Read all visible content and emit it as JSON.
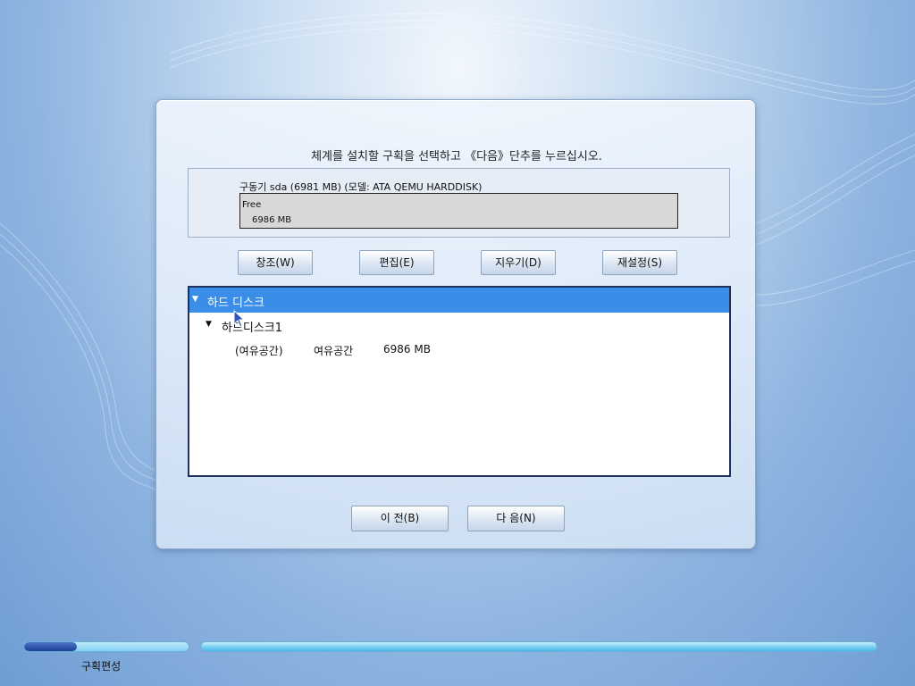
{
  "dialog": {
    "instruction": "체계를 설치할 구획을 선택하고 《다음》단추를 누르십시오.",
    "drive": {
      "label": "구동기 sda (6981 MB) (모델: ATA QEMU HARDDISK)",
      "bar_name": "Free",
      "bar_size": "6986 MB"
    },
    "buttons": {
      "create": "창조(W)",
      "edit": "편집(E)",
      "delete": "지우기(D)",
      "reset": "재설정(S)"
    },
    "tree": {
      "root_label": "하드 디스크",
      "disk_label": "하드디스크1",
      "free_row": {
        "device": "(여유공간)",
        "type": "여유공간",
        "size": "6986 MB"
      }
    },
    "nav": {
      "back": "이 전(B)",
      "next": "다 음(N)"
    }
  },
  "status": {
    "step_label": "구획편성",
    "step_progress": 0.32
  },
  "colors": {
    "selection": "#3b8ee8",
    "tree_border": "#1f2f5e",
    "progress_fill": "#1d3f98"
  }
}
